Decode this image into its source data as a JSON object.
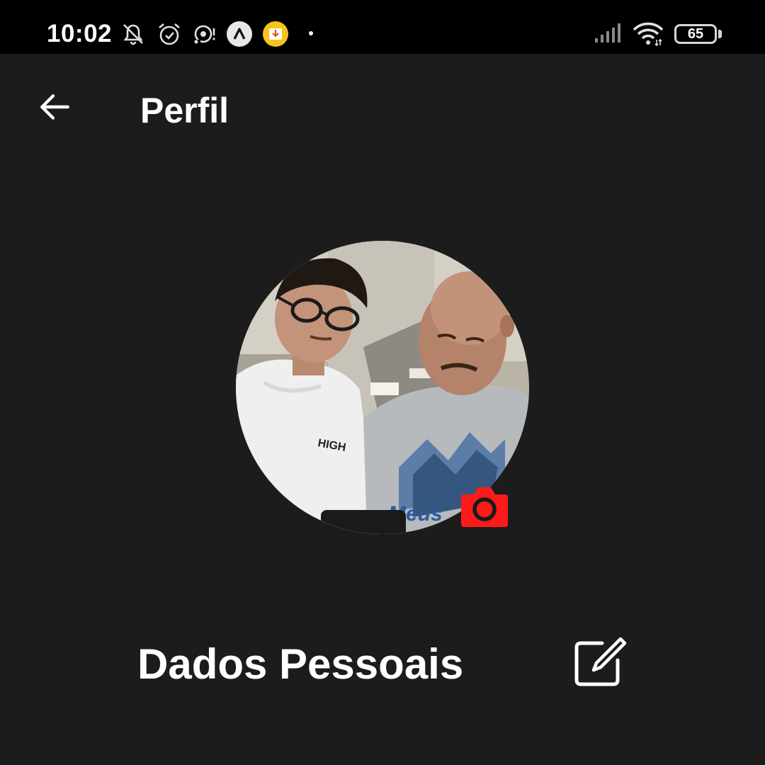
{
  "status_bar": {
    "time": "10:02",
    "battery_level": "65",
    "icons": [
      "bell-off-icon",
      "alarm-icon",
      "cast-icon",
      "app-a-icon",
      "download-icon",
      "signal-icon",
      "wifi-icon",
      "battery-icon"
    ]
  },
  "header": {
    "title": "Perfil",
    "back_icon": "arrow-left-icon"
  },
  "profile": {
    "camera_icon": "camera-icon",
    "accent_color": "#ff1a1a"
  },
  "section": {
    "title": "Dados Pessoais",
    "edit_icon": "edit-icon"
  },
  "colors": {
    "background": "#1c1c1c",
    "status_bar": "#000000",
    "text": "#ffffff"
  }
}
